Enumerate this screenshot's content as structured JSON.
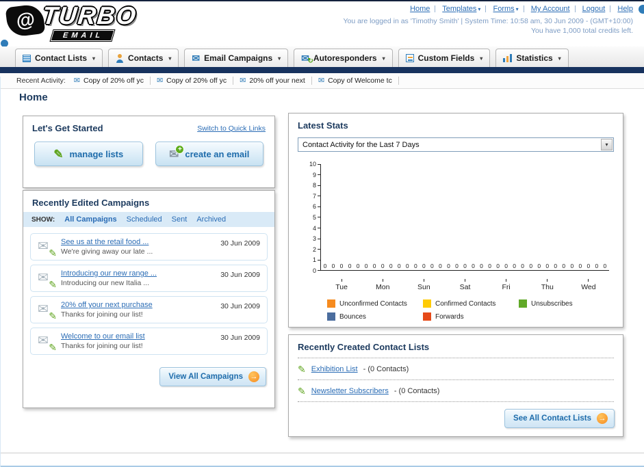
{
  "icons": {
    "envelope": "✉",
    "pencil": "✎",
    "caret": "▾",
    "arrow": "→",
    "plus": "+",
    "refresh": "↻",
    "at": "@"
  },
  "header": {
    "logo_main": "TURBO",
    "logo_sub": "EMAIL",
    "nav": [
      {
        "label": "Home"
      },
      {
        "label": "Templates"
      },
      {
        "label": "Forms"
      },
      {
        "label": "My Account"
      },
      {
        "label": "Logout"
      },
      {
        "label": "Help"
      }
    ],
    "login_info": "You are logged in as 'Timothy Smith' | System Time: 10:58 am, 30 Jun 2009 - (GMT+10:00)",
    "credits": "You have 1,000 total credits left."
  },
  "tabs": [
    {
      "label": "Contact Lists"
    },
    {
      "label": "Contacts"
    },
    {
      "label": "Email Campaigns"
    },
    {
      "label": "Autoresponders"
    },
    {
      "label": "Custom Fields"
    },
    {
      "label": "Statistics"
    }
  ],
  "recent_activity": {
    "label": "Recent Activity:",
    "items": [
      "Copy of 20% off yc",
      "Copy of 20% off yc",
      "20% off your next",
      "Copy of Welcome tc"
    ]
  },
  "page": {
    "title": "Home"
  },
  "get_started": {
    "title": "Let's Get Started",
    "switch_link": "Switch to Quick Links",
    "manage_button": "manage lists",
    "create_button": "create an email"
  },
  "campaigns": {
    "title": "Recently Edited Campaigns",
    "show_label": "SHOW:",
    "filters": [
      "All Campaigns",
      "Scheduled",
      "Sent",
      "Archived"
    ],
    "items": [
      {
        "title": "See us at the retail food ...",
        "subtitle": "We're giving away our late ...",
        "date": "30 Jun 2009"
      },
      {
        "title": "Introducing our new range ...",
        "subtitle": "Introducing our new Italia ...",
        "date": "30 Jun 2009"
      },
      {
        "title": "20% off your next purchase",
        "subtitle": "Thanks for joining our list!",
        "date": "30 Jun 2009"
      },
      {
        "title": "Welcome to our email list",
        "subtitle": "Thanks for joining our list!",
        "date": "30 Jun 2009"
      }
    ],
    "view_all_button": "View All Campaigns"
  },
  "stats": {
    "title": "Latest Stats",
    "dropdown_value": "Contact Activity for the Last 7 Days"
  },
  "chart_data": {
    "type": "bar",
    "title": "Contact Activity for the Last 7 Days",
    "categories": [
      "Tue",
      "Mon",
      "Sun",
      "Sat",
      "Fri",
      "Thu",
      "Wed"
    ],
    "series": [
      {
        "name": "Unconfirmed Contacts",
        "color": "#f68b1f",
        "values": [
          0,
          0,
          0,
          0,
          0,
          0,
          0
        ]
      },
      {
        "name": "Confirmed Contacts",
        "color": "#ffcb05",
        "values": [
          0,
          0,
          0,
          0,
          0,
          0,
          0
        ]
      },
      {
        "name": "Unsubscribes",
        "color": "#61a928",
        "values": [
          0,
          0,
          0,
          0,
          0,
          0,
          0
        ]
      },
      {
        "name": "Bounces",
        "color": "#4b6d9e",
        "values": [
          0,
          0,
          0,
          0,
          0,
          0,
          0
        ]
      },
      {
        "name": "Forwards",
        "color": "#e64a19",
        "values": [
          0,
          0,
          0,
          0,
          0,
          0,
          0
        ]
      }
    ],
    "ylim": [
      0,
      10
    ],
    "yticks": [
      0,
      1,
      2,
      3,
      4,
      5,
      6,
      7,
      8,
      9,
      10
    ],
    "grid": false,
    "legend_position": "bottom"
  },
  "contact_lists": {
    "title": "Recently Created Contact Lists",
    "items": [
      {
        "name": "Exhibition List",
        "count": "- (0 Contacts)"
      },
      {
        "name": "Newsletter Subscribers",
        "count": "- (0 Contacts)"
      }
    ],
    "see_all_button": "See All Contact Lists"
  }
}
